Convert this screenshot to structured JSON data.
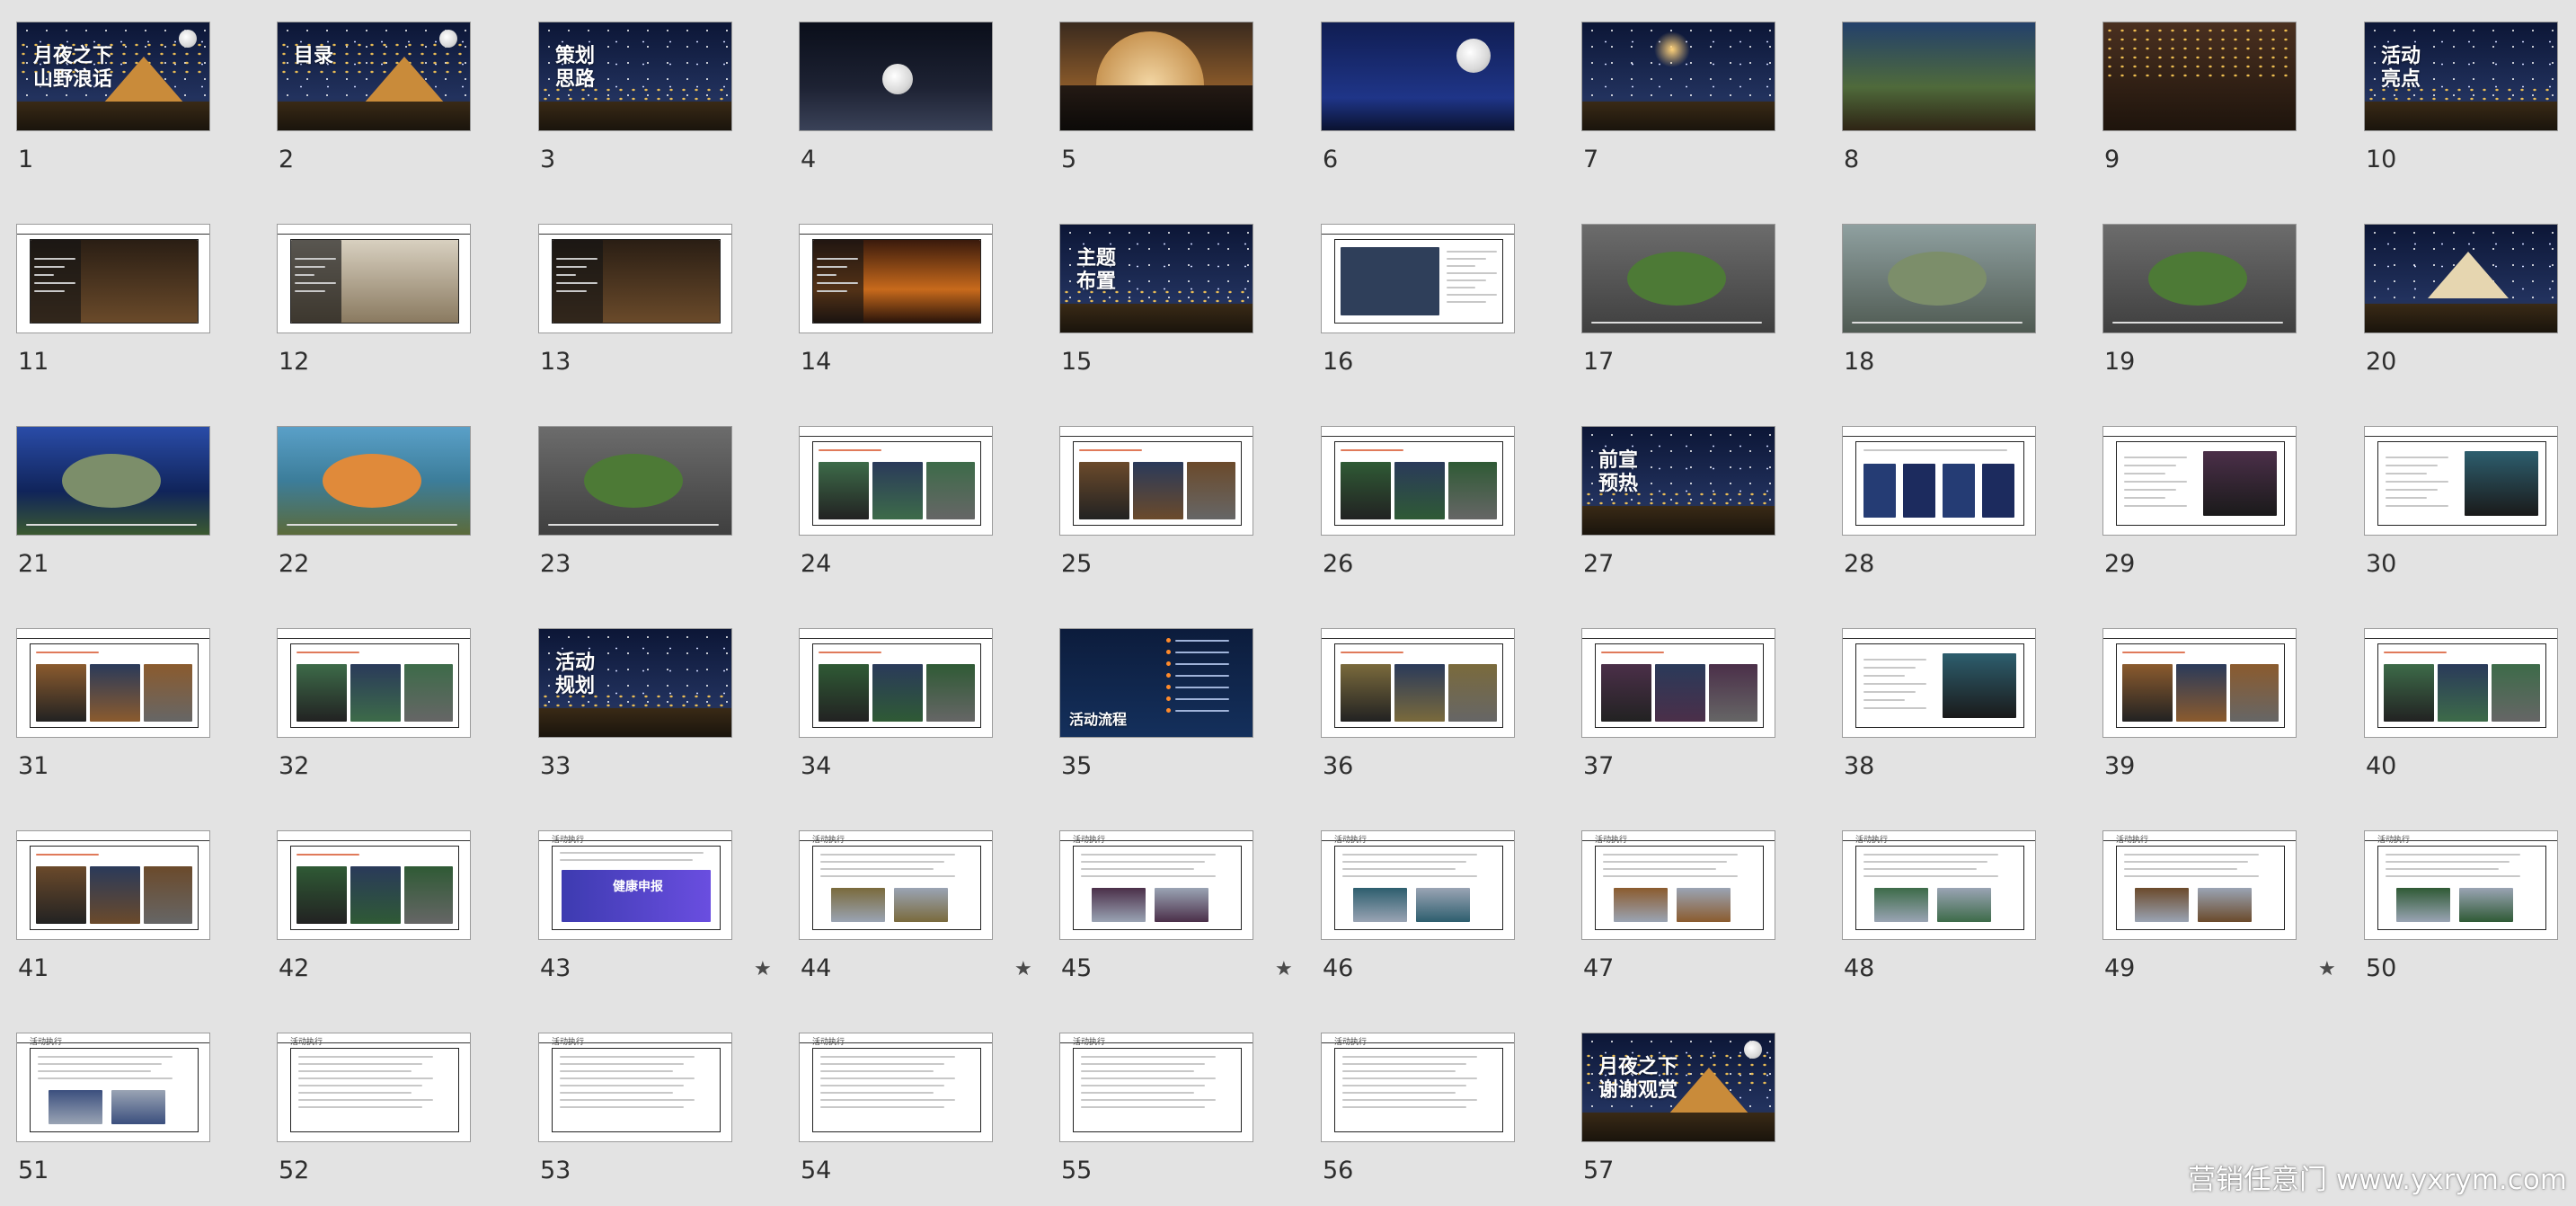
{
  "app": {
    "view": "slide-sorter"
  },
  "slides": [
    {
      "number": "1",
      "style": "cover",
      "title": "月夜之下 山野浪话"
    },
    {
      "number": "2",
      "style": "cover",
      "title": "目录"
    },
    {
      "number": "3",
      "style": "section",
      "title": "策划 思路"
    },
    {
      "number": "4",
      "style": "moon-water"
    },
    {
      "number": "5",
      "style": "city-moon"
    },
    {
      "number": "6",
      "style": "moon-blue"
    },
    {
      "number": "7",
      "style": "lanterns"
    },
    {
      "number": "8",
      "style": "camp-photo"
    },
    {
      "number": "9",
      "style": "camp-lights"
    },
    {
      "number": "10",
      "style": "section",
      "title": "活动 亮点"
    },
    {
      "number": "11",
      "style": "white-photo"
    },
    {
      "number": "12",
      "style": "white-photo-tent"
    },
    {
      "number": "13",
      "style": "white-photo"
    },
    {
      "number": "14",
      "style": "white-photo-fire"
    },
    {
      "number": "15",
      "style": "section",
      "title": "主题 布置"
    },
    {
      "number": "16",
      "style": "white-chart"
    },
    {
      "number": "17",
      "style": "render-green"
    },
    {
      "number": "18",
      "style": "render-mall"
    },
    {
      "number": "19",
      "style": "render-green"
    },
    {
      "number": "20",
      "style": "camp-night"
    },
    {
      "number": "21",
      "style": "stage-blue"
    },
    {
      "number": "22",
      "style": "kids-play"
    },
    {
      "number": "23",
      "style": "render-green"
    },
    {
      "number": "24",
      "style": "white-photos"
    },
    {
      "number": "25",
      "style": "white-photos"
    },
    {
      "number": "26",
      "style": "white-photos"
    },
    {
      "number": "27",
      "style": "section",
      "title": "前宣 预热"
    },
    {
      "number": "28",
      "style": "white-posters"
    },
    {
      "number": "29",
      "style": "white-photo-right"
    },
    {
      "number": "30",
      "style": "white-photo-right"
    },
    {
      "number": "31",
      "style": "white-photos"
    },
    {
      "number": "32",
      "style": "white-photos"
    },
    {
      "number": "33",
      "style": "section",
      "title": "活动 规划"
    },
    {
      "number": "34",
      "style": "white-photos"
    },
    {
      "number": "35",
      "style": "timeline",
      "title": "活动流程"
    },
    {
      "number": "36",
      "style": "white-photos"
    },
    {
      "number": "37",
      "style": "white-photos"
    },
    {
      "number": "38",
      "style": "white-photo-right"
    },
    {
      "number": "39",
      "style": "white-photos"
    },
    {
      "number": "40",
      "style": "white-photos"
    },
    {
      "number": "41",
      "style": "white-photos"
    },
    {
      "number": "42",
      "style": "white-photos"
    },
    {
      "number": "43",
      "style": "exec-banner",
      "title": "活动执行",
      "banner": "健康申报",
      "starred": true
    },
    {
      "number": "44",
      "style": "exec-text",
      "title": "活动执行",
      "starred": true
    },
    {
      "number": "45",
      "style": "exec-text",
      "title": "活动执行",
      "starred": true
    },
    {
      "number": "46",
      "style": "exec-text",
      "title": "活动执行"
    },
    {
      "number": "47",
      "style": "exec-text",
      "title": "活动执行"
    },
    {
      "number": "48",
      "style": "exec-text",
      "title": "活动执行"
    },
    {
      "number": "49",
      "style": "exec-text",
      "title": "活动执行",
      "starred": true
    },
    {
      "number": "50",
      "style": "exec-text",
      "title": "活动执行"
    },
    {
      "number": "51",
      "style": "exec-text",
      "title": "活动执行"
    },
    {
      "number": "52",
      "style": "exec-text",
      "title": "活动执行"
    },
    {
      "number": "53",
      "style": "exec-text",
      "title": "活动执行"
    },
    {
      "number": "54",
      "style": "exec-text",
      "title": "活动执行"
    },
    {
      "number": "55",
      "style": "exec-text",
      "title": "活动执行"
    },
    {
      "number": "56",
      "style": "exec-text",
      "title": "活动执行"
    },
    {
      "number": "57",
      "style": "cover",
      "title": "月夜之下 谢谢观赏"
    }
  ],
  "star_glyph": "★",
  "watermark": "营销任意门 www.yxrym.com",
  "colors": {
    "background": "#e3e3e3",
    "slide_border": "#9b9b9b",
    "number_text": "#2e2e2e"
  }
}
